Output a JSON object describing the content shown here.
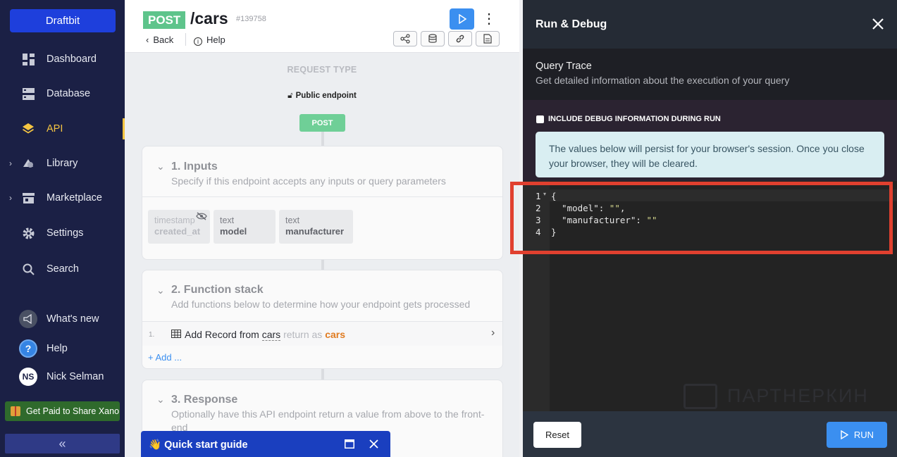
{
  "sidebar": {
    "brand": "Draftbit",
    "items": [
      {
        "label": "Dashboard"
      },
      {
        "label": "Database"
      },
      {
        "label": "API"
      },
      {
        "label": "Library"
      },
      {
        "label": "Marketplace"
      },
      {
        "label": "Settings"
      },
      {
        "label": "Search"
      }
    ],
    "footer": [
      {
        "label": "What's new"
      },
      {
        "label": "Help"
      },
      {
        "label": "Nick Selman",
        "initials": "NS"
      }
    ],
    "promo": "Get Paid to Share Xano",
    "collapse_glyph": "«"
  },
  "endpoint": {
    "method": "POST",
    "route": "/cars",
    "id": "#139758",
    "back": "Back",
    "help": "Help"
  },
  "request": {
    "type_label": "REQUEST TYPE",
    "access": "Public endpoint",
    "method_pill": "POST"
  },
  "inputs_card": {
    "title": "1. Inputs",
    "subtitle": "Specify if this endpoint accepts any inputs or query parameters",
    "fields": [
      {
        "type": "timestamp",
        "name": "created_at"
      },
      {
        "type": "text",
        "name": "model"
      },
      {
        "type": "text",
        "name": "manufacturer"
      }
    ]
  },
  "function_card": {
    "title": "2. Function stack",
    "subtitle": "Add functions below to determine how your endpoint gets processed",
    "step_num": "1.",
    "step_action": "Add Record from",
    "step_table": "cars",
    "step_return": "return as",
    "step_var": "cars",
    "add_label": "+ Add ..."
  },
  "response_card": {
    "title": "3. Response",
    "subtitle": "Optionally have this API endpoint return a value from above to the front-end"
  },
  "quick_start": {
    "label": "👋 Quick start guide"
  },
  "panel": {
    "title": "Run & Debug",
    "trace_title": "Query Trace",
    "trace_sub": "Get detailed information about the execution of your query",
    "debug_option": "INCLUDE DEBUG INFORMATION DURING RUN",
    "info": "The values below will persist for your browser's session. Once you close your browser, they will be cleared.",
    "line_numbers": [
      "1",
      "2",
      "3",
      "4"
    ],
    "code": {
      "l1": "{",
      "l2_key": "  \"model\": ",
      "l2_val": "\"\"",
      "l2_tail": ",",
      "l3_key": "  \"manufacturer\": ",
      "l3_val": "\"\"",
      "l4": "}"
    },
    "watermark": "ПАРТНЕРКИН",
    "reset": "Reset",
    "run": "RUN"
  },
  "colors": {
    "sidebar_bg": "#1b2045",
    "brand_blue": "#1e3fdc",
    "accent_yellow": "#f5c542",
    "post_green": "#5ec48b",
    "run_blue": "#3b8ff0",
    "highlight_red": "#e0402f"
  }
}
